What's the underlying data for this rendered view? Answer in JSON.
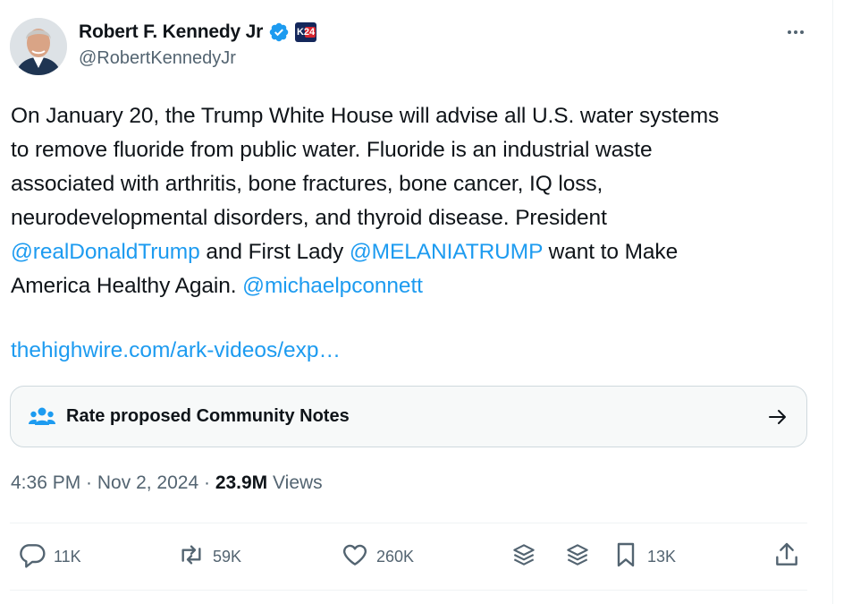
{
  "author": {
    "name": "Robert F. Kennedy Jr",
    "handle": "@RobertKennedyJr",
    "badge_text": "K24"
  },
  "tweet": {
    "lines": [
      [
        {
          "t": "On January 20, the Trump White House will advise all U.S. water systems",
          "type": "text"
        }
      ],
      [
        {
          "t": "to remove fluoride from public water. Fluoride is an industrial waste",
          "type": "text"
        }
      ],
      [
        {
          "t": "associated with arthritis, bone fractures, bone cancer, IQ loss,",
          "type": "text"
        }
      ],
      [
        {
          "t": "neurodevelopmental disorders, and thyroid disease. President",
          "type": "text"
        }
      ],
      [
        {
          "t": "@realDonaldTrump",
          "type": "mention"
        },
        {
          "t": " and First Lady ",
          "type": "text"
        },
        {
          "t": "@MELANIATRUMP",
          "type": "mention"
        },
        {
          "t": " want to Make",
          "type": "text"
        }
      ],
      [
        {
          "t": "America Healthy Again. ",
          "type": "text"
        },
        {
          "t": "@michaelpconnett",
          "type": "mention"
        }
      ]
    ],
    "link": "thehighwire.com/ark-videos/exp…"
  },
  "community_notes": {
    "label": "Rate proposed Community Notes"
  },
  "meta": {
    "time": "4:36 PM",
    "sep1": " · ",
    "date": "Nov 2, 2024",
    "sep2": " · ",
    "views_count": "23.9M",
    "views_label": " Views"
  },
  "actions": {
    "replies": "11K",
    "reposts": "59K",
    "likes": "260K",
    "bookmarks": "13K"
  },
  "colors": {
    "accent": "#1d9bf0",
    "text": "#0f1419",
    "secondary": "#536471",
    "border": "#cfd9de"
  },
  "icons": [
    "verified-badge-icon",
    "more-icon",
    "community-notes-icon",
    "arrow-right-icon",
    "reply-icon",
    "repost-icon",
    "like-icon",
    "grok-icon",
    "bookmark-icon",
    "share-icon"
  ]
}
